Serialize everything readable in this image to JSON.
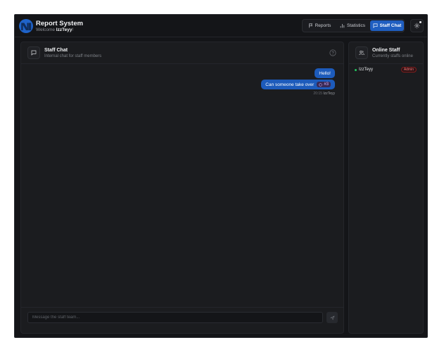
{
  "header": {
    "title": "Report System",
    "welcome_prefix": "Welcome",
    "username": "IzzTeyy",
    "welcome_suffix": "!"
  },
  "nav": {
    "items": [
      {
        "label": "Reports",
        "icon": "flag-icon"
      },
      {
        "label": "Statistics",
        "icon": "bar-chart-icon"
      },
      {
        "label": "Staff Chat",
        "icon": "message-square-icon",
        "active": true
      }
    ],
    "settings_icon": "gear-icon"
  },
  "chat": {
    "title": "Staff Chat",
    "subtitle": "Internal chat for staff members",
    "messages": [
      {
        "text": "Hello!"
      },
      {
        "text": "Can someone take over",
        "tag": "#3",
        "time": "20:15",
        "author": "IzzTeyy"
      }
    ],
    "input_placeholder": "Message the staff team..."
  },
  "online": {
    "title": "Online Staff",
    "subtitle": "Currently staffs online",
    "staff": [
      {
        "name": "IzzTeyy",
        "role": "Admin"
      }
    ]
  },
  "colors": {
    "accent": "#1f5ec0",
    "online": "#22c55e",
    "admin_badge": "#f87171"
  }
}
